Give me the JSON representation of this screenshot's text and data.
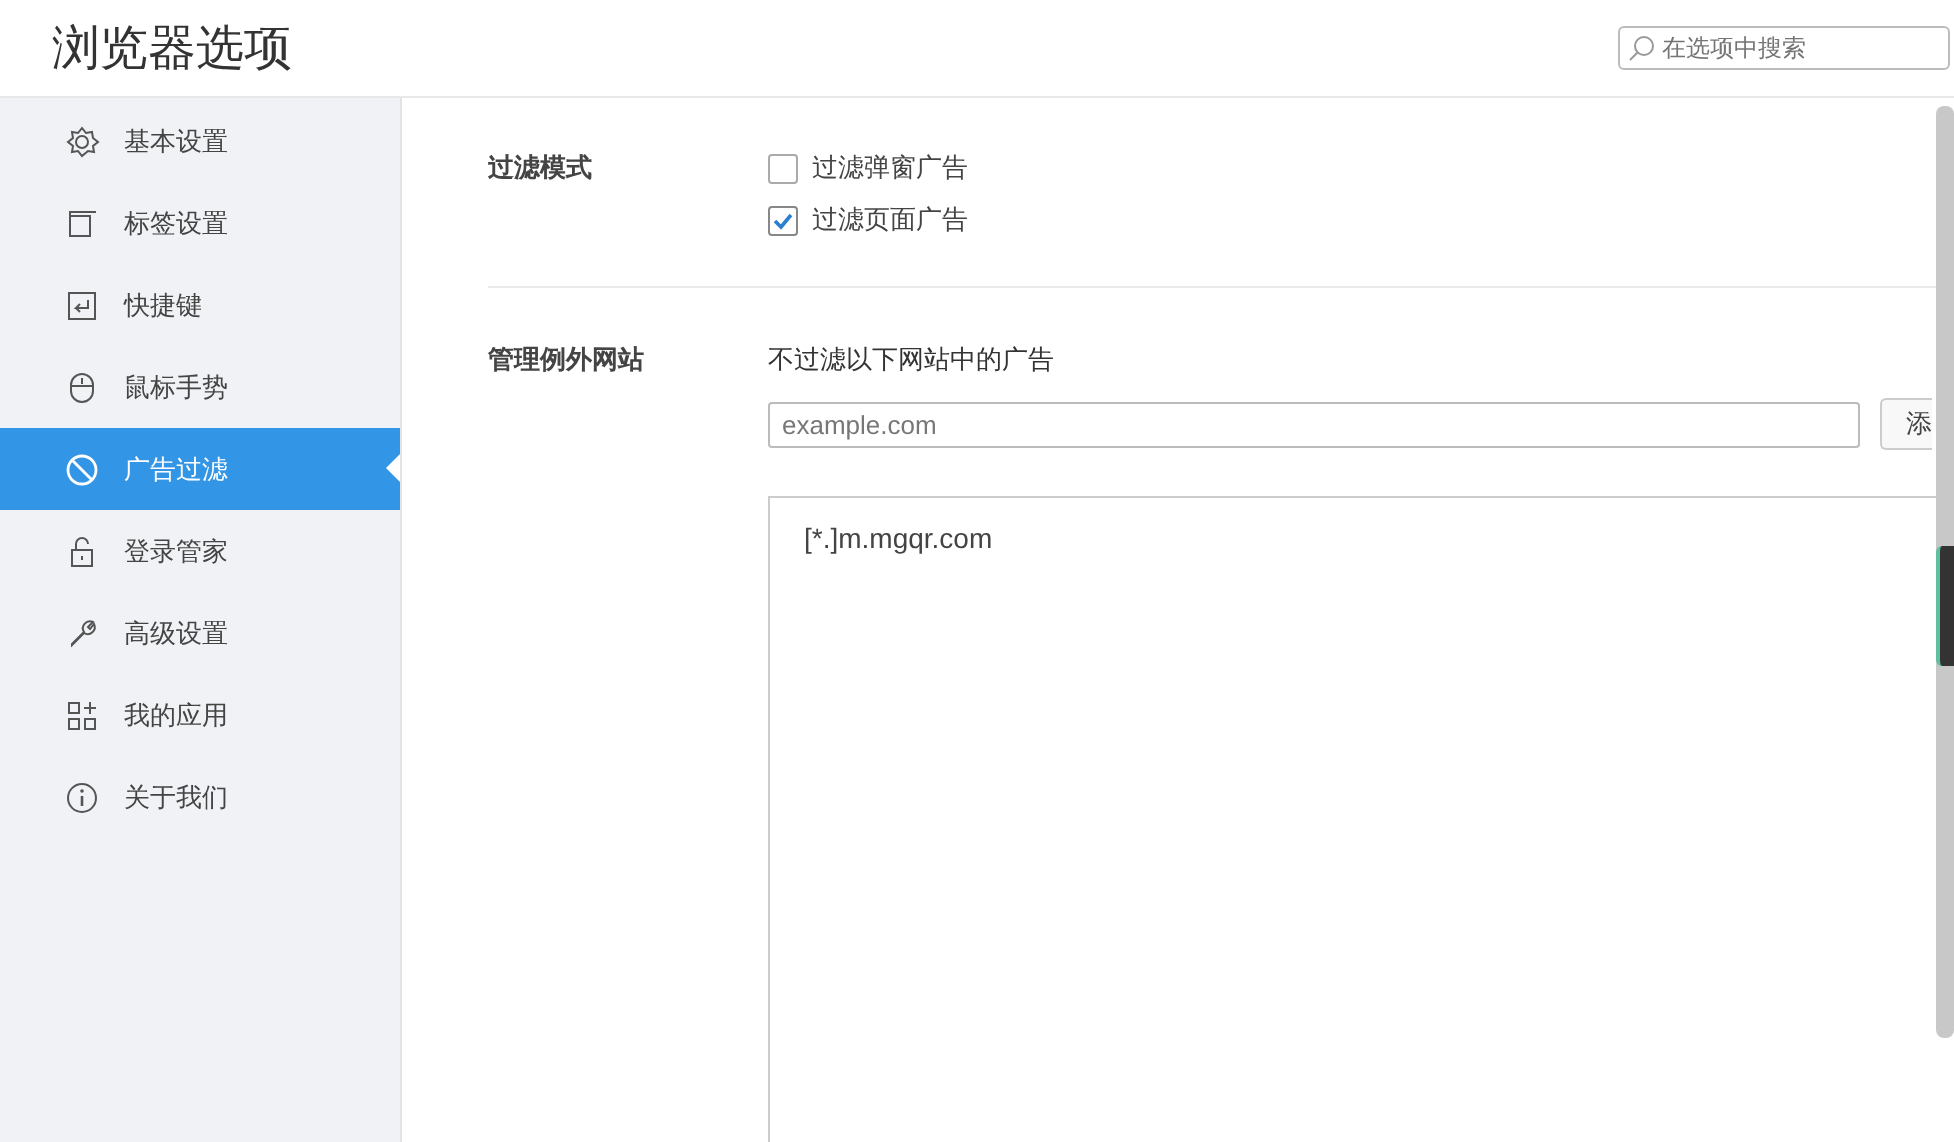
{
  "window": {
    "title": "浏览器选项"
  },
  "search": {
    "placeholder": "在选项中搜索"
  },
  "sidebar": {
    "items": [
      {
        "label": "基本设置",
        "selected": false
      },
      {
        "label": "标签设置",
        "selected": false
      },
      {
        "label": "快捷键",
        "selected": false
      },
      {
        "label": "鼠标手势",
        "selected": false
      },
      {
        "label": "广告过滤",
        "selected": true
      },
      {
        "label": "登录管家",
        "selected": false
      },
      {
        "label": "高级设置",
        "selected": false
      },
      {
        "label": "我的应用",
        "selected": false
      },
      {
        "label": "关于我们",
        "selected": false
      }
    ]
  },
  "filter_mode": {
    "label": "过滤模式",
    "options": [
      {
        "label": "过滤弹窗广告",
        "checked": false
      },
      {
        "label": "过滤页面广告",
        "checked": true
      }
    ]
  },
  "exceptions": {
    "label": "管理例外网站",
    "hint": "不过滤以下网站中的广告",
    "input": {
      "placeholder": "example.com"
    },
    "add_button": "添",
    "sites": [
      "[*.]m.mgqr.com"
    ]
  }
}
